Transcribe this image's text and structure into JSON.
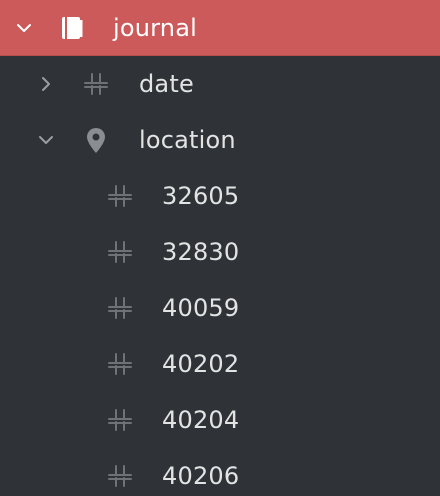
{
  "tree": {
    "root": {
      "label": "journal",
      "icon": "notebook-icon",
      "expanded": true,
      "highlight_color": "#cc5a5a"
    },
    "children": [
      {
        "label": "date",
        "icon": "field-icon",
        "expanded": false
      },
      {
        "label": "location",
        "icon": "map-pin-icon",
        "expanded": true,
        "items": [
          {
            "label": "32605",
            "icon": "field-icon"
          },
          {
            "label": "32830",
            "icon": "field-icon"
          },
          {
            "label": "40059",
            "icon": "field-icon"
          },
          {
            "label": "40202",
            "icon": "field-icon"
          },
          {
            "label": "40204",
            "icon": "field-icon"
          },
          {
            "label": "40206",
            "icon": "field-icon"
          }
        ]
      }
    ]
  }
}
